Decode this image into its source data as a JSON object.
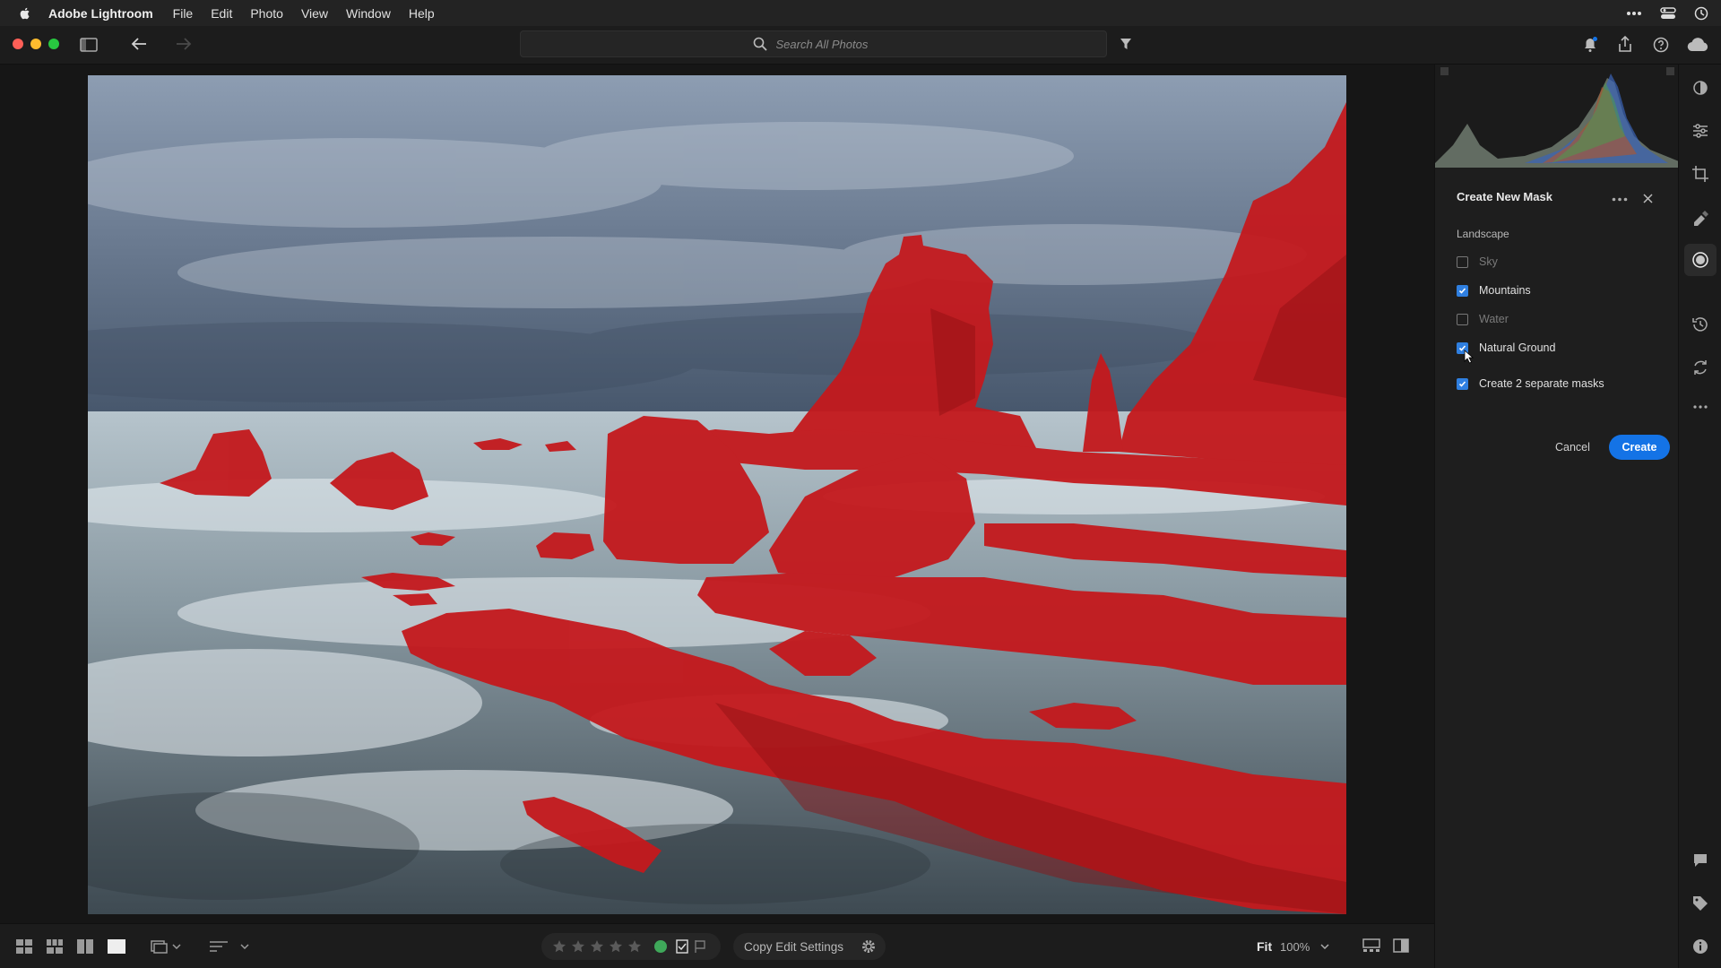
{
  "menubar": {
    "app_name": "Adobe Lightroom",
    "items": [
      "File",
      "Edit",
      "Photo",
      "View",
      "Window",
      "Help"
    ]
  },
  "toolbar": {
    "search_placeholder": "Search All Photos"
  },
  "mask_panel": {
    "title": "Create New Mask",
    "section": "Landscape",
    "options": [
      {
        "label": "Sky",
        "checked": false
      },
      {
        "label": "Mountains",
        "checked": true
      },
      {
        "label": "Water",
        "checked": false
      },
      {
        "label": "Natural Ground",
        "checked": true
      }
    ],
    "separate_masks": {
      "label": "Create 2 separate masks",
      "checked": true
    },
    "cancel_label": "Cancel",
    "create_label": "Create"
  },
  "bottom_bar": {
    "copy_edit_label": "Copy Edit Settings",
    "zoom_fit": "Fit",
    "zoom_percent": "100%"
  },
  "colors": {
    "accent": "#1473e6",
    "mask_overlay": "#c4191d",
    "traffic_red": "#ff5f57",
    "traffic_yellow": "#febc2e",
    "traffic_green": "#28c840"
  }
}
